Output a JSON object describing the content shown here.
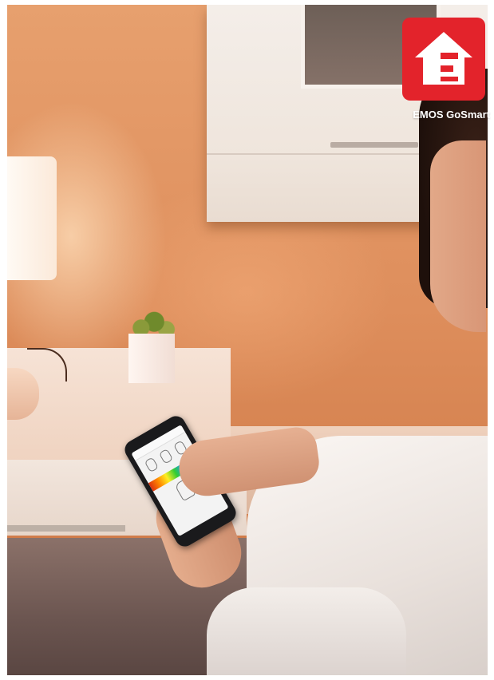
{
  "brand": {
    "name": "EMOS GoSmart",
    "logo_icon": "house-e-logo-icon",
    "logo_color": "#e3232b"
  },
  "scene": {
    "icon": "photo-scene",
    "accent_wall_color": "#de8e5c"
  }
}
